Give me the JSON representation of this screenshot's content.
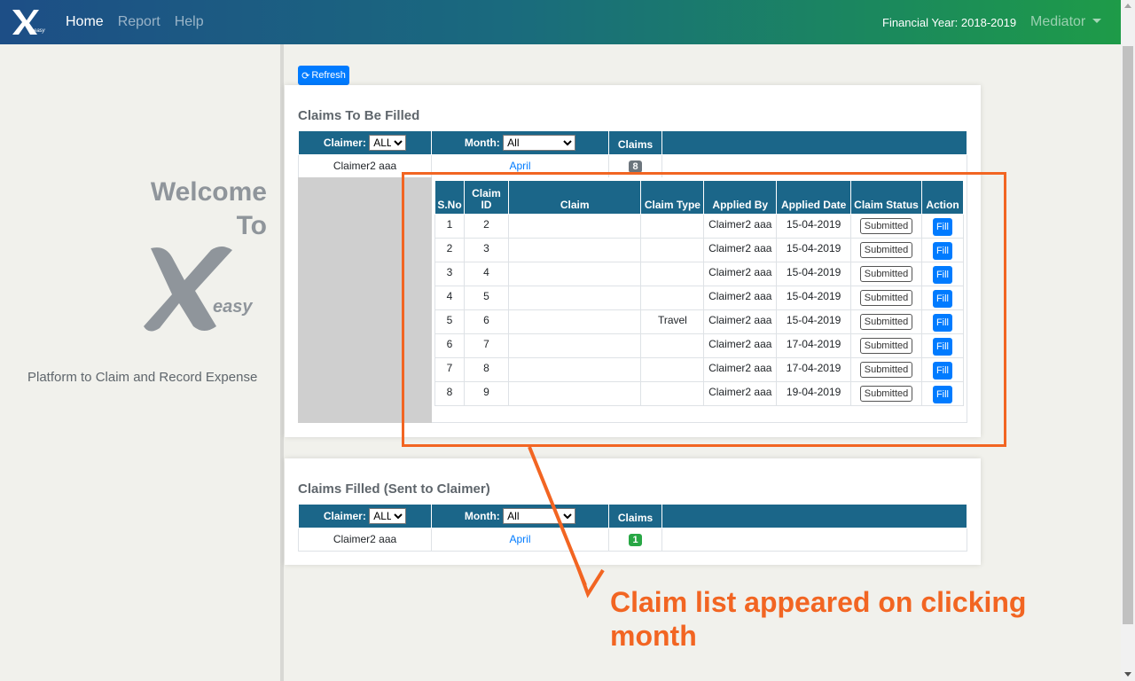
{
  "nav": {
    "brand_text": "easy",
    "links": [
      "Home",
      "Report",
      "Help"
    ],
    "financial_year": "Financial Year: 2018-2019",
    "user": "Mediator"
  },
  "left": {
    "welcome": "Welcome",
    "to": "To",
    "logo_word": "easy",
    "tagline": "Platform to Claim and Record Expense"
  },
  "refresh_label": "Refresh",
  "to_be_filled": {
    "title": "Claims To Be Filled",
    "claimer_label": "Claimer:",
    "claimer_value": "ALL",
    "month_label": "Month:",
    "month_value": "All",
    "claims_label": "Claims",
    "row": {
      "claimer": "Claimer2 aaa",
      "month": "April",
      "count": "8"
    }
  },
  "detail": {
    "headers": [
      "S.No",
      "Claim ID",
      "Claim",
      "Claim Type",
      "Applied By",
      "Applied Date",
      "Claim Status",
      "Action"
    ],
    "rows": [
      {
        "sno": "1",
        "id": "2",
        "claim": "",
        "type": "",
        "by": "Claimer2 aaa",
        "date": "15-04-2019",
        "status": "Submitted",
        "action": "Fill"
      },
      {
        "sno": "2",
        "id": "3",
        "claim": "",
        "type": "",
        "by": "Claimer2 aaa",
        "date": "15-04-2019",
        "status": "Submitted",
        "action": "Fill"
      },
      {
        "sno": "3",
        "id": "4",
        "claim": "",
        "type": "",
        "by": "Claimer2 aaa",
        "date": "15-04-2019",
        "status": "Submitted",
        "action": "Fill"
      },
      {
        "sno": "4",
        "id": "5",
        "claim": "",
        "type": "",
        "by": "Claimer2 aaa",
        "date": "15-04-2019",
        "status": "Submitted",
        "action": "Fill"
      },
      {
        "sno": "5",
        "id": "6",
        "claim": "",
        "type": "Travel",
        "by": "Claimer2 aaa",
        "date": "15-04-2019",
        "status": "Submitted",
        "action": "Fill"
      },
      {
        "sno": "6",
        "id": "7",
        "claim": "",
        "type": "",
        "by": "Claimer2 aaa",
        "date": "17-04-2019",
        "status": "Submitted",
        "action": "Fill"
      },
      {
        "sno": "7",
        "id": "8",
        "claim": "",
        "type": "",
        "by": "Claimer2 aaa",
        "date": "17-04-2019",
        "status": "Submitted",
        "action": "Fill"
      },
      {
        "sno": "8",
        "id": "9",
        "claim": "",
        "type": "",
        "by": "Claimer2 aaa",
        "date": "19-04-2019",
        "status": "Submitted",
        "action": "Fill"
      }
    ]
  },
  "filled": {
    "title": "Claims Filled (Sent to Claimer)",
    "claimer_label": "Claimer:",
    "claimer_value": "ALL",
    "month_label": "Month:",
    "month_value": "All",
    "claims_label": "Claims",
    "row": {
      "claimer": "Claimer2 aaa",
      "month": "April",
      "count": "1"
    }
  },
  "annotation": "Claim list appeared on clicking month",
  "colors": {
    "header_blue": "#1b6689",
    "primary": "#007bff",
    "annotation": "#f26522",
    "badge_green": "#28a745"
  }
}
